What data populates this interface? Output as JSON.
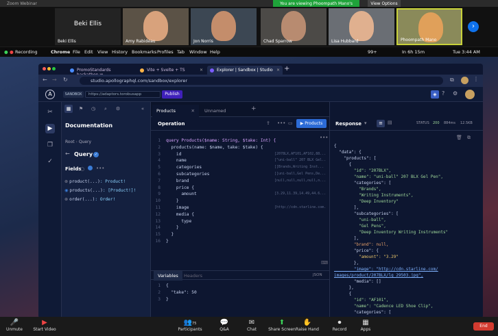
{
  "zoom": {
    "title": "Zoom Webinar",
    "banner": "You are viewing Phoompath Mano's screen",
    "view_options": "View Options",
    "participants": [
      {
        "name": "Beki Ellis"
      },
      {
        "name": "Amy Rabideau"
      },
      {
        "name": "Jon Norris"
      },
      {
        "name": "Chad Sparrow"
      },
      {
        "name": "Lisa Hubbard"
      },
      {
        "name": "Phoompath Mano"
      }
    ],
    "participants_count": "75",
    "controls": [
      "Unmute",
      "Start Video",
      "Participants",
      "Q&A",
      "Chat",
      "Share Screen",
      "Raise Hand",
      "Record",
      "Apps"
    ],
    "end": "End"
  },
  "mac_menu": {
    "recording": "Recording",
    "app": "Chrome",
    "items": [
      "File",
      "Edit",
      "View",
      "History",
      "Bookmarks",
      "Profiles",
      "Tab",
      "Window",
      "Help"
    ],
    "battery": "99+",
    "timer": "In 6h 15m",
    "clock": "Tue 3:44 AM"
  },
  "browser": {
    "tabs": [
      {
        "label": "PromoStandards hackathon w",
        "color": "#4a8cff"
      },
      {
        "label": "Vite + Svelte + TS",
        "color": "#ffb347"
      },
      {
        "label": "Explorer | Sandbox | Studio",
        "color": "#3f20ba"
      }
    ],
    "url": "studio.apollographql.com/sandbox/explorer"
  },
  "studio": {
    "sandbox_label": "SANDBOX",
    "endpoint": "https://adaptors.torobusapp",
    "publish": "Publish"
  },
  "docs": {
    "title": "Documentation",
    "breadcrumb": [
      "Root",
      "Query"
    ],
    "section": "Query",
    "fields_label": "Fields",
    "fields": [
      {
        "name": "product(...)",
        "type": ": Product!"
      },
      {
        "name": "products(...)",
        "type": ": [Product!]!"
      },
      {
        "name": "order(...)",
        "type": ": Order!"
      }
    ]
  },
  "editor": {
    "tabs": [
      "Products",
      "Unnamed"
    ],
    "operation_label": "Operation",
    "run_label": "Products",
    "lines": [
      {
        "n": "1",
        "text": "query Products($name: String, $take: Int) {",
        "hint": ""
      },
      {
        "n": "2",
        "text": "  products(name: $name, take: $take) {",
        "hint": ""
      },
      {
        "n": "3",
        "text": "    id",
        "hint": "[2078LX,AF101,AF102,88..."
      },
      {
        "n": "4",
        "text": "    name",
        "hint": "[\"uni-ball\" 207 BLX Gel..."
      },
      {
        "n": "5",
        "text": "    categories",
        "hint": "[[Brands,Writing Inst..."
      },
      {
        "n": "6",
        "text": "    subcategories",
        "hint": "[[uni-ball,Gel Pens,De..."
      },
      {
        "n": "7",
        "text": "    brand",
        "hint": "[null,null,null,null,n..."
      },
      {
        "n": "8",
        "text": "    price {",
        "hint": ""
      },
      {
        "n": "9",
        "text": "      amount",
        "hint": "[3.29,11.39,14.49,44.6..."
      },
      {
        "n": "10",
        "text": "    }",
        "hint": ""
      },
      {
        "n": "11",
        "text": "    image",
        "hint": "[http://cdn.starline.com..."
      },
      {
        "n": "12",
        "text": "    media {",
        "hint": ""
      },
      {
        "n": "13",
        "text": "      type",
        "hint": ""
      },
      {
        "n": "14",
        "text": "    }",
        "hint": ""
      },
      {
        "n": "15",
        "text": "  }",
        "hint": ""
      },
      {
        "n": "16",
        "text": "}",
        "hint": ""
      }
    ],
    "variables_tab": "Variables",
    "headers_tab": "Headers",
    "json_label": "JSON",
    "variables": [
      {
        "n": "1",
        "text": "{"
      },
      {
        "n": "2",
        "text": "  \"take\": 50"
      },
      {
        "n": "3",
        "text": "}"
      }
    ]
  },
  "response": {
    "label": "Response",
    "status_label": "STATUS",
    "status": "200",
    "time": "884ms",
    "size": "12.5KB",
    "lines": [
      {
        "text": "{",
        "cls": ""
      },
      {
        "text": "  \"data\": {",
        "cls": ""
      },
      {
        "text": "    \"products\": [",
        "cls": ""
      },
      {
        "text": "      {",
        "cls": ""
      },
      {
        "text": "        \"id\": \"207BLX\",",
        "cls": "str"
      },
      {
        "text": "        \"name\": \"uni-ball\" 207 BLX Gel Pen\",",
        "cls": "str"
      },
      {
        "text": "        \"categories\": [",
        "cls": ""
      },
      {
        "text": "          \"Brands\",",
        "cls": "str"
      },
      {
        "text": "          \"Writing Instruments\",",
        "cls": "str"
      },
      {
        "text": "          \"Deep Inventory\"",
        "cls": "str"
      },
      {
        "text": "        ],",
        "cls": ""
      },
      {
        "text": "        \"subcategories\": [",
        "cls": ""
      },
      {
        "text": "          \"uni-ball\",",
        "cls": "str"
      },
      {
        "text": "          \"Gel Pens\",",
        "cls": "str"
      },
      {
        "text": "          \"Deep Inventory Writing Instruments\"",
        "cls": "str"
      },
      {
        "text": "        ],",
        "cls": ""
      },
      {
        "text": "        \"brand\": null,",
        "cls": "nul"
      },
      {
        "text": "        \"price\": {",
        "cls": ""
      },
      {
        "text": "          \"amount\": \"3.29\"",
        "cls": "num"
      },
      {
        "text": "        },",
        "cls": ""
      },
      {
        "text": "        \"image\": \"http://cdn.starline.com/",
        "cls": "url"
      },
      {
        "text": "images/product/207BLX/lg_29503.jpg\",",
        "cls": "url"
      },
      {
        "text": "        \"media\": []",
        "cls": ""
      },
      {
        "text": "      },",
        "cls": ""
      },
      {
        "text": "      {",
        "cls": ""
      },
      {
        "text": "        \"id\": \"AF101\",",
        "cls": "str"
      },
      {
        "text": "        \"name\": \"Cadence LED Shoe Clip\",",
        "cls": "str"
      },
      {
        "text": "        \"categories\": [",
        "cls": ""
      }
    ]
  }
}
